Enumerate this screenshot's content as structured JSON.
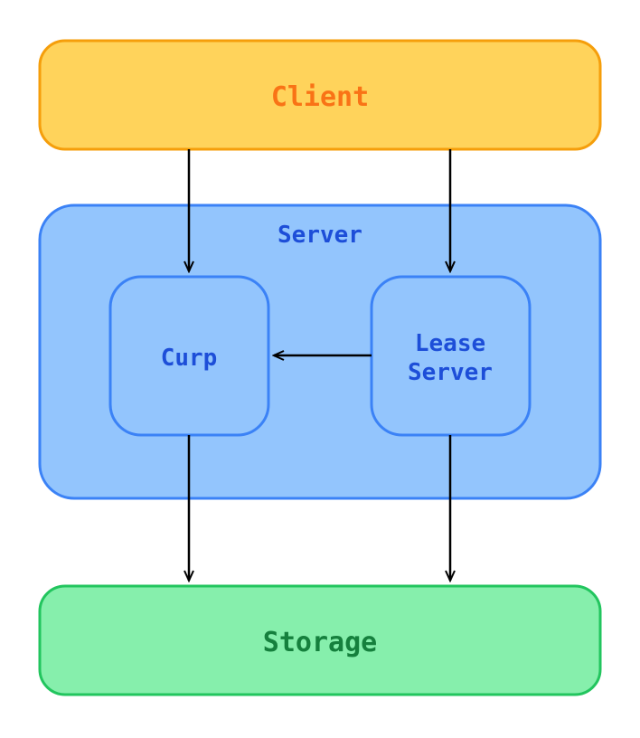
{
  "nodes": {
    "client": {
      "label": "Client",
      "fill": "#ffd35b",
      "stroke": "#f59e0b",
      "text": "#f97316"
    },
    "server": {
      "label": "Server",
      "fill": "#93c5fd",
      "stroke": "#3b82f6",
      "text": "#1d4ed8"
    },
    "curp": {
      "label": "Curp",
      "fill": "#93c5fd",
      "stroke": "#3b82f6",
      "text": "#1d4ed8"
    },
    "lease": {
      "label_line1": "Lease",
      "label_line2": "Server",
      "fill": "#93c5fd",
      "stroke": "#3b82f6",
      "text": "#1d4ed8"
    },
    "storage": {
      "label": "Storage",
      "fill": "#86efac",
      "stroke": "#22c55e",
      "text": "#15803d"
    }
  },
  "edges": [
    {
      "from": "client",
      "to": "curp"
    },
    {
      "from": "client",
      "to": "lease"
    },
    {
      "from": "lease",
      "to": "curp"
    },
    {
      "from": "curp",
      "to": "storage"
    },
    {
      "from": "lease",
      "to": "storage"
    }
  ]
}
